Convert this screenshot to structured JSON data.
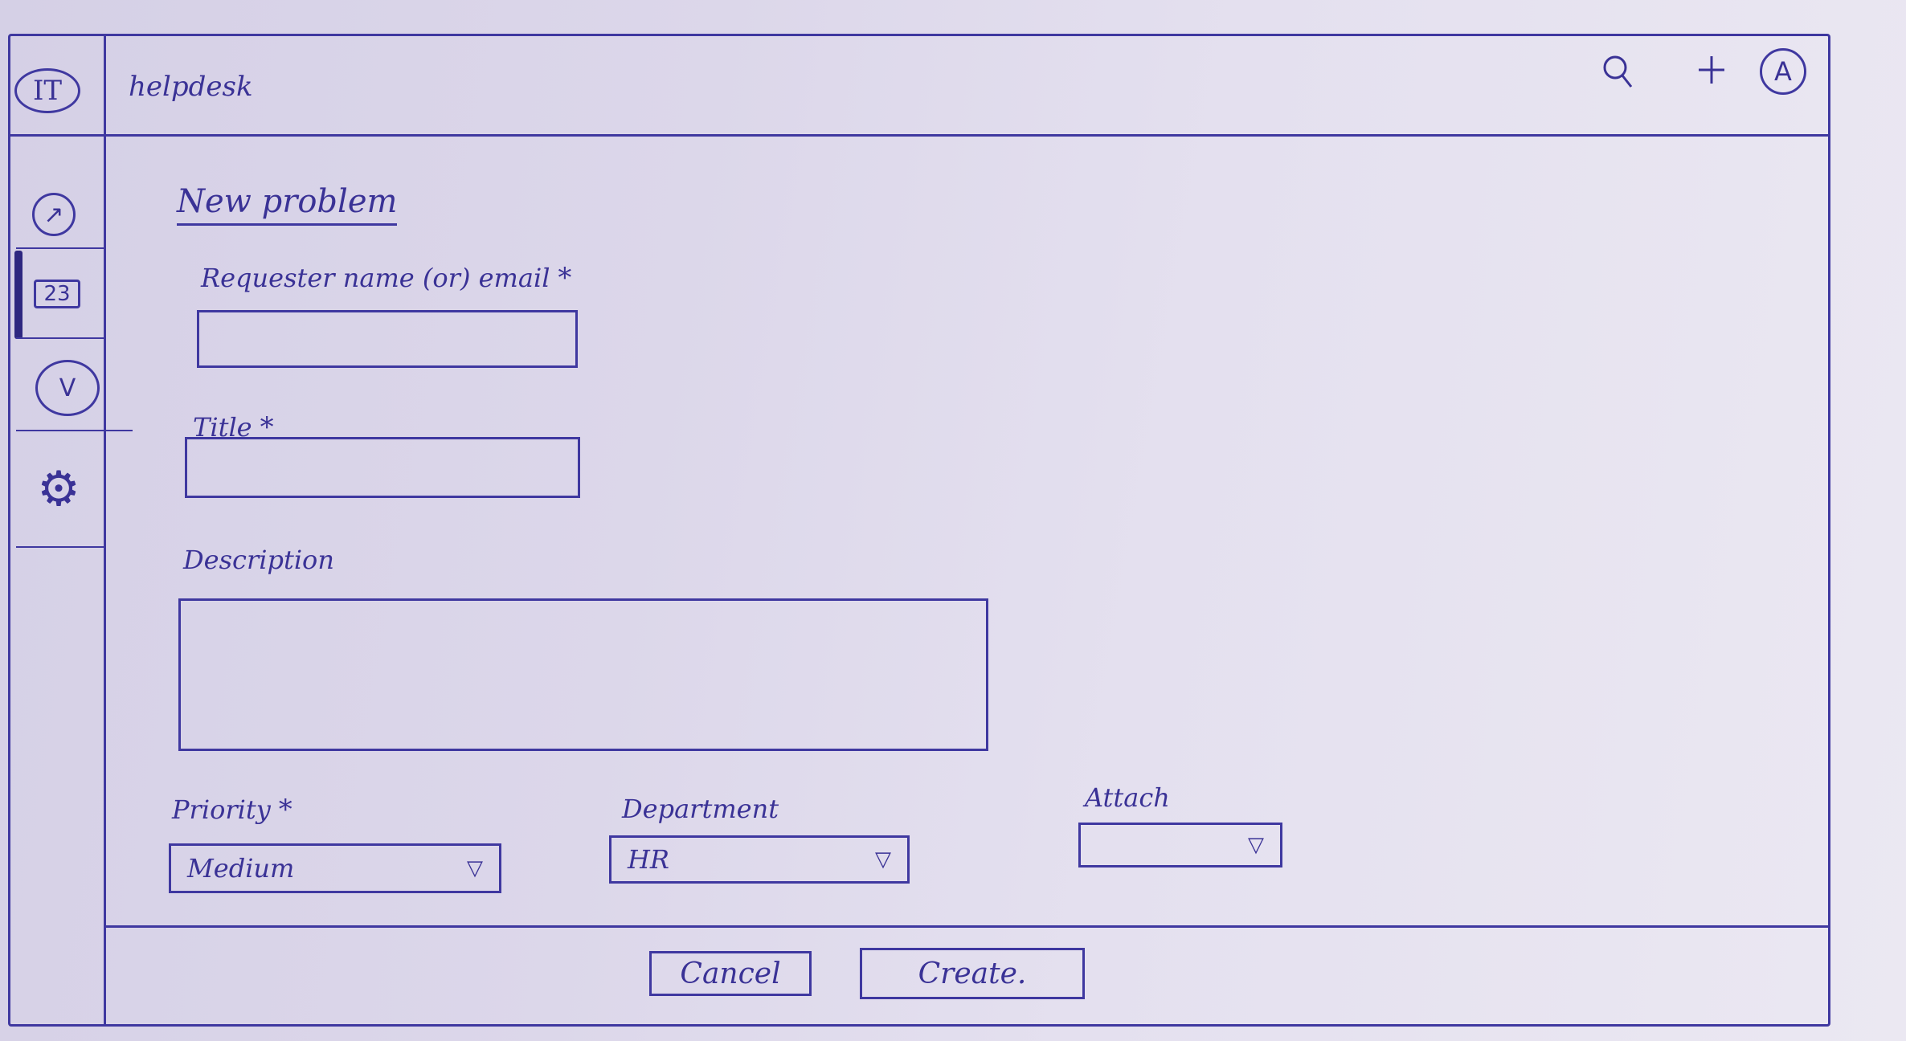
{
  "app": {
    "logo_text": "IT",
    "title": "helpdesk"
  },
  "topbar": {
    "search_icon": "search-icon",
    "add_icon": "plus-icon",
    "avatar_initial": "A"
  },
  "sidebar": {
    "items": [
      {
        "icon": "arrow-up-right-icon",
        "glyph": "↗"
      },
      {
        "icon": "ticket-icon",
        "glyph": "23",
        "active": true
      },
      {
        "icon": "check-v-icon",
        "glyph": "V"
      },
      {
        "icon": "gear-icon",
        "glyph": "⚙"
      }
    ]
  },
  "form": {
    "heading": "New problem",
    "requester": {
      "label": "Requester name (or) email",
      "required_mark": "*",
      "value": ""
    },
    "title": {
      "label": "Title",
      "required_mark": "*",
      "value": ""
    },
    "description": {
      "label": "Description",
      "value": ""
    },
    "priority": {
      "label": "Priority",
      "required_mark": "*",
      "value": "Medium"
    },
    "department": {
      "label": "Department",
      "value": "HR"
    },
    "attach": {
      "label": "Attach",
      "value": ""
    }
  },
  "actions": {
    "cancel_label": "Cancel",
    "create_label": "Create."
  },
  "colors": {
    "ink": "#3a3296",
    "paper": "#e4e0ef"
  }
}
